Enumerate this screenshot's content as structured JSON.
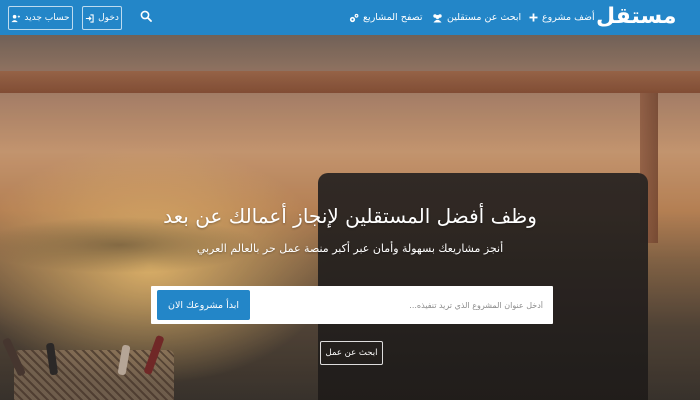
{
  "navbar": {
    "logo": "مستقل",
    "links": [
      {
        "label": "أضف مشروع",
        "icon": "plus-icon"
      },
      {
        "label": "ابحث عن مستقلين",
        "icon": "users-icon"
      },
      {
        "label": "تصفح المشاريع",
        "icon": "cogs-icon"
      }
    ],
    "search_icon": "search-icon",
    "login_label": "دخول",
    "login_icon": "sign-in-icon",
    "register_label": "حساب جديد",
    "register_icon": "user-plus-icon",
    "color": "#2386c8"
  },
  "hero": {
    "title": "وظف أفضل المستقلين لإنجاز أعمالك عن بعد",
    "subtitle": "أنجز مشاريعك بسهولة وأمان عبر أكبر منصة عمل حر بالعالم العربي",
    "search": {
      "placeholder": "أدخل عنوان المشروع الذي تريد تنفيذه...",
      "button_label": "ابدأ مشروعك الان"
    },
    "find_work_label": "ابحث عن عمل"
  }
}
